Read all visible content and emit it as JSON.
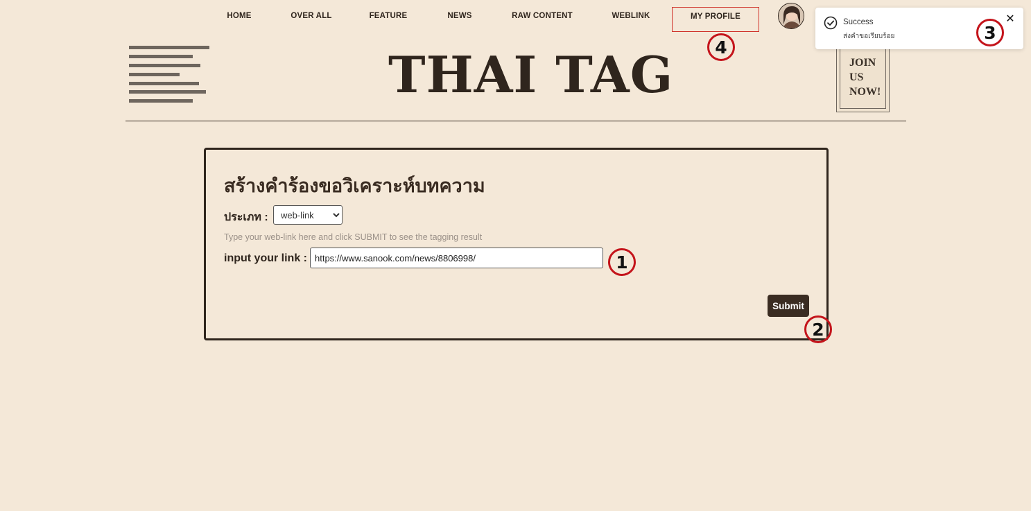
{
  "nav": {
    "items": [
      {
        "label": "HOME"
      },
      {
        "label": "OVER ALL"
      },
      {
        "label": "FEATURE"
      },
      {
        "label": "NEWS"
      },
      {
        "label": "RAW CONTENT"
      },
      {
        "label": "WEBLINK"
      },
      {
        "label": "MY PROFILE",
        "active": true
      }
    ]
  },
  "header": {
    "logo": "THAI TAG",
    "join": [
      "JOIN",
      "US",
      "NOW!"
    ]
  },
  "form": {
    "title": "สร้างคำร้องขอวิเคราะห์บทความ",
    "type_label": "ประเภท :",
    "type_value": "web-link",
    "hint": "Type your web-link here and click SUBMIT to see the tagging result",
    "link_label": "input your link :",
    "link_value": "https://www.sanook.com/news/8806998/",
    "submit_label": "Submit"
  },
  "toast": {
    "title": "Success",
    "message": "ส่งคำขอเรียบร้อย",
    "close": "✕"
  },
  "markers": [
    "1",
    "2",
    "3",
    "4"
  ],
  "colors": {
    "background": "#f4e8d8",
    "text_dark": "#2f251d",
    "button_bg": "#3a2c22",
    "active_border": "#d0332b",
    "marker_ring": "#c4141b"
  }
}
